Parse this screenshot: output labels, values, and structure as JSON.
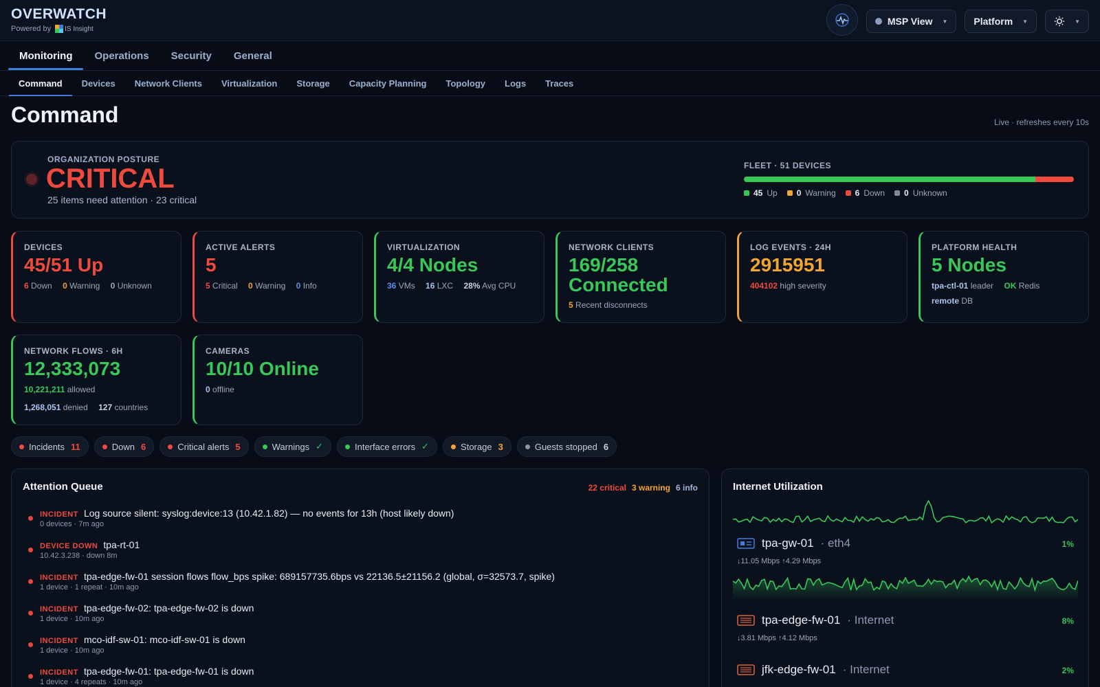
{
  "header": {
    "brand": "OVERWATCH",
    "powered_by": "Powered by",
    "logo_text": "IS Insight",
    "view_button": "MSP View",
    "platform_button": "Platform",
    "theme_icon": "sun-icon",
    "pulse_icon": "pulse-icon"
  },
  "nav": {
    "primary_tabs": [
      "Monitoring",
      "Operations",
      "Security",
      "General"
    ],
    "active_primary": "Monitoring",
    "secondary_tabs": [
      "Command",
      "Devices",
      "Network Clients",
      "Virtualization",
      "Storage",
      "Capacity Planning",
      "Topology",
      "Logs",
      "Traces"
    ],
    "active_secondary": "Command"
  },
  "page": {
    "title": "Command",
    "live_text": "Live · refreshes every 10s"
  },
  "posture": {
    "label": "ORGANIZATION POSTURE",
    "status": "CRITICAL",
    "summary": "25 items need attention · 23 critical",
    "fleet_label": "FLEET · 51 DEVICES",
    "fleet": {
      "up": {
        "count": "45",
        "label": "Up",
        "color": "#39c75a"
      },
      "warning": {
        "count": "0",
        "label": "Warning",
        "color": "#f2a530"
      },
      "down": {
        "count": "6",
        "label": "Down",
        "color": "#ef4a3e"
      },
      "unknown": {
        "count": "0",
        "label": "Unknown",
        "color": "#7d8a9c"
      }
    }
  },
  "cards": {
    "devices": {
      "label": "DEVICES",
      "value": "45/51 Up",
      "down": "6",
      "down_label": "Down",
      "warning": "0",
      "warning_label": "Warning",
      "unknown": "0",
      "unknown_label": "Unknown"
    },
    "alerts": {
      "label": "ACTIVE ALERTS",
      "value": "5",
      "critical": "5",
      "critical_label": "Critical",
      "warning": "0",
      "warning_label": "Warning",
      "info": "0",
      "info_label": "Info"
    },
    "virtualization": {
      "label": "VIRTUALIZATION",
      "value": "4/4 Nodes",
      "vms": "36",
      "vms_label": "VMs",
      "lxc": "16",
      "lxc_label": "LXC",
      "cpu": "28%",
      "cpu_label": "Avg CPU"
    },
    "clients": {
      "label": "NETWORK CLIENTS",
      "value_line1": "169/258",
      "value_line2": "Connected",
      "disconnects": "5",
      "disconnects_label": "Recent disconnects"
    },
    "logs": {
      "label": "LOG EVENTS · 24H",
      "value": "2915951",
      "high": "404102",
      "high_label": "high severity"
    },
    "platform": {
      "label": "PLATFORM HEALTH",
      "value": "5 Nodes",
      "leader": "tpa-ctl-01",
      "leader_label": "leader",
      "redis": "OK",
      "redis_label": "Redis",
      "db": "remote",
      "db_label": "DB"
    },
    "flows": {
      "label": "NETWORK FLOWS · 6H",
      "value": "12,333,073",
      "allowed": "10,221,211",
      "allowed_label": "allowed",
      "denied": "1,268,051",
      "denied_label": "denied",
      "countries": "127",
      "countries_label": "countries"
    },
    "cameras": {
      "label": "CAMERAS",
      "value": "10/10 Online",
      "offline": "0",
      "offline_label": "offline"
    }
  },
  "chips": [
    {
      "label": "Incidents",
      "count": "11",
      "color": "#ef4a3e"
    },
    {
      "label": "Down",
      "count": "6",
      "color": "#ef4a3e"
    },
    {
      "label": "Critical alerts",
      "count": "5",
      "color": "#ef4a3e"
    },
    {
      "label": "Warnings",
      "count": "✓",
      "color": "#39c75a"
    },
    {
      "label": "Interface errors",
      "count": "✓",
      "color": "#39c75a"
    },
    {
      "label": "Storage",
      "count": "3",
      "color": "#f2a530"
    },
    {
      "label": "Guests stopped",
      "count": "6",
      "color": "#8a96a8"
    }
  ],
  "queue": {
    "title": "Attention Queue",
    "critical": "22 critical",
    "warning": "3 warning",
    "info": "6 info",
    "items": [
      {
        "type": "INCIDENT",
        "text": "Log source silent: syslog:device:13 (10.42.1.82) — no events for 13h (host likely down)",
        "meta": "0 devices · 7m ago"
      },
      {
        "type": "DEVICE DOWN",
        "text": "tpa-rt-01",
        "meta": "10.42.3.238 · down 8m"
      },
      {
        "type": "INCIDENT",
        "text": "tpa-edge-fw-01 session flows flow_bps spike: 689157735.6bps vs 22136.5±21156.2 (global, σ=32573.7, spike)",
        "meta": "1 device · 1 repeat · 10m ago"
      },
      {
        "type": "INCIDENT",
        "text": "tpa-edge-fw-02: tpa-edge-fw-02 is down",
        "meta": "1 device · 10m ago"
      },
      {
        "type": "INCIDENT",
        "text": "mco-idf-sw-01: mco-idf-sw-01 is down",
        "meta": "1 device · 10m ago"
      },
      {
        "type": "INCIDENT",
        "text": "tpa-edge-fw-01: tpa-edge-fw-01 is down",
        "meta": "1 device · 4 repeats · 10m ago"
      }
    ]
  },
  "internet": {
    "title": "Internet Utilization",
    "links": [
      {
        "device": "tpa-gw-01",
        "iface": "eth4",
        "pct": "1%",
        "down": "↓11.05 Mbps",
        "up": "↑4.29 Mbps",
        "icon": "gateway-icon",
        "icon_color": "#3f7fde"
      },
      {
        "device": "tpa-edge-fw-01",
        "iface": "Internet",
        "pct": "8%",
        "down": "↓3.81 Mbps",
        "up": "↑4.12 Mbps",
        "icon": "firewall-icon",
        "icon_color": "#e0623a"
      },
      {
        "device": "jfk-edge-fw-01",
        "iface": "Internet",
        "pct": "2%",
        "icon": "firewall-icon",
        "icon_color": "#e0623a"
      }
    ]
  },
  "colors": {
    "accent": "#3f7fde",
    "ok": "#39c75a",
    "critical": "#ef4a3e",
    "warning": "#f2a530",
    "info": "#5b8de6"
  }
}
